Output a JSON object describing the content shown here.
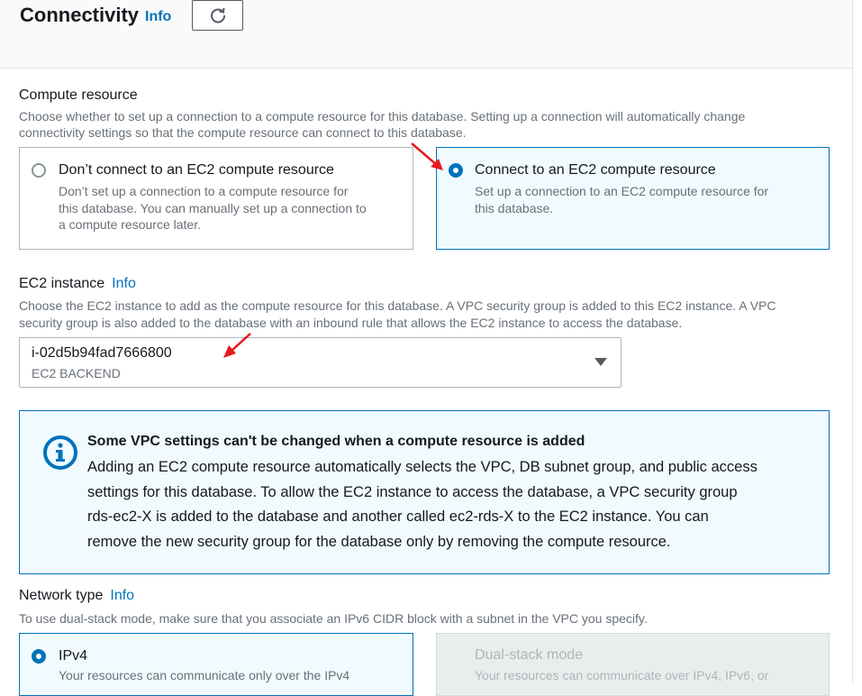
{
  "header": {
    "title": "Connectivity",
    "info": "Info"
  },
  "compute": {
    "label": "Compute resource",
    "description_line1": "Choose whether to set up a connection to a compute resource for this database. Setting up a connection will automatically change",
    "description_line2": "connectivity settings so that the compute resource can connect to this database.",
    "options": [
      {
        "title": "Don’t connect to an EC2 compute resource",
        "desc_line1": "Don’t set up a connection to a compute resource for",
        "desc_line2": "this database. You can manually set up a connection to",
        "desc_line3": "a compute resource later.",
        "selected": false
      },
      {
        "title": "Connect to an EC2 compute resource",
        "desc_line1": "Set up a connection to an EC2 compute resource for",
        "desc_line2": "this database.",
        "selected": true
      }
    ]
  },
  "ec2": {
    "label": "EC2 instance",
    "info": "Info",
    "description_line1": "Choose the EC2 instance to add as the compute resource for this database. A VPC security group is added to this EC2 instance. A VPC",
    "description_line2": "security group is also added to the database with an inbound rule that allows the EC2 instance to access the database.",
    "selected_value": "i-02d5b94fad7666800",
    "selected_name": "EC2 BACKEND"
  },
  "alert": {
    "title": "Some VPC settings can't be changed when a compute resource is added",
    "line1": "Adding an EC2 compute resource automatically selects the VPC, DB subnet group, and public access",
    "line2": "settings for this database. To allow the EC2 instance to access the database, a VPC security group",
    "line3": "rds-ec2-X is added to the database and another called ec2-rds-X to the EC2 instance. You can",
    "line4": "remove the new security group for the database only by removing the compute resource."
  },
  "network": {
    "label": "Network type",
    "info": "Info",
    "description": "To use dual-stack mode, make sure that you associate an IPv6 CIDR block with a subnet in the VPC you specify.",
    "options": [
      {
        "title": "IPv4",
        "desc": "Your resources can communicate only over the IPv4",
        "selected": true
      },
      {
        "title": "Dual-stack mode",
        "desc": "Your resources can communicate over IPv4, IPv6, or",
        "disabled": true
      }
    ]
  },
  "colors": {
    "accent": "#0073bb",
    "annotation_arrow": "#e8191e"
  }
}
